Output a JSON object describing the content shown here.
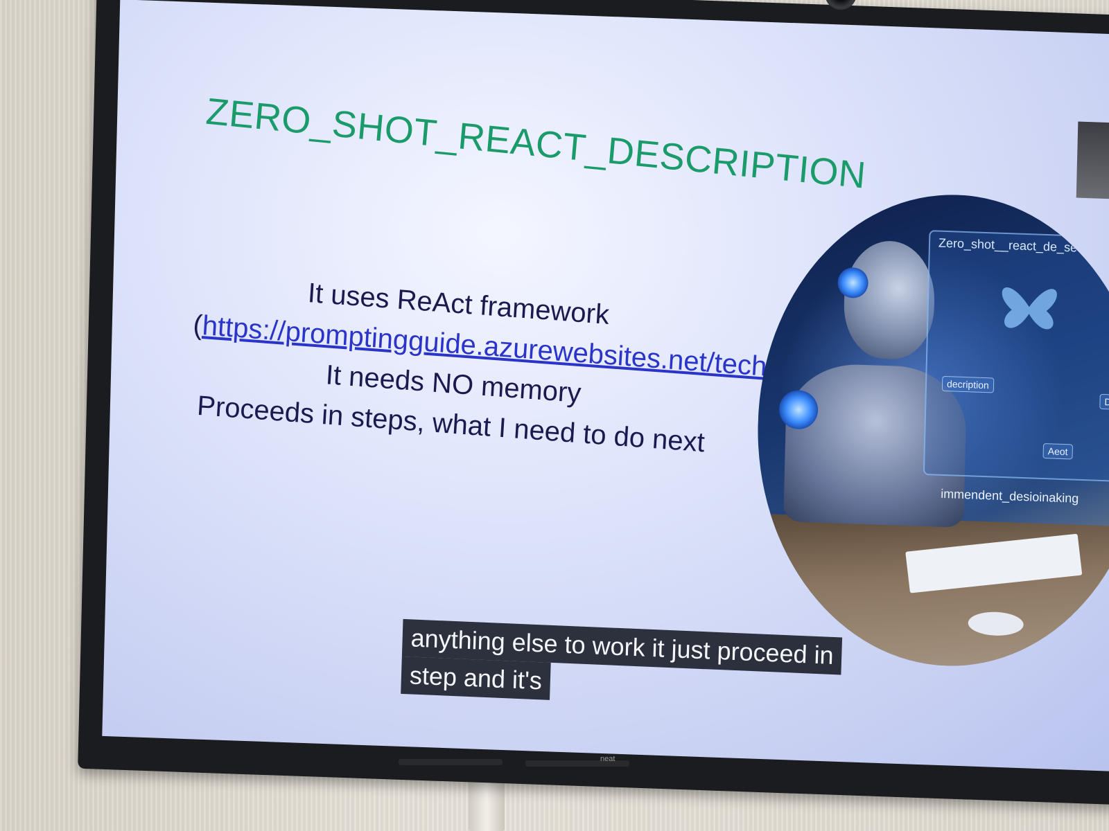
{
  "slide": {
    "title": "ZERO_SHOT_REACT_DESCRIPTION",
    "line1": "It uses ReAct framework",
    "link_open_paren": "(",
    "link_text": "https://promptingguide.azurewebsites.net/techniques/react",
    "link_close_paren": ")",
    "line2": "It needs NO memory",
    "line3": "Proceeds in steps, what I need to do next"
  },
  "illustration": {
    "panel_title": "Zero_shot__react_de_se",
    "label_a": "decription",
    "label_b": "Aeot",
    "label_c": "immendent_desioinaking",
    "label_d": "Decc"
  },
  "caption": {
    "line1": "anything else to work it just proceed in",
    "line2": "step and it's"
  },
  "tv_brand": "neat"
}
